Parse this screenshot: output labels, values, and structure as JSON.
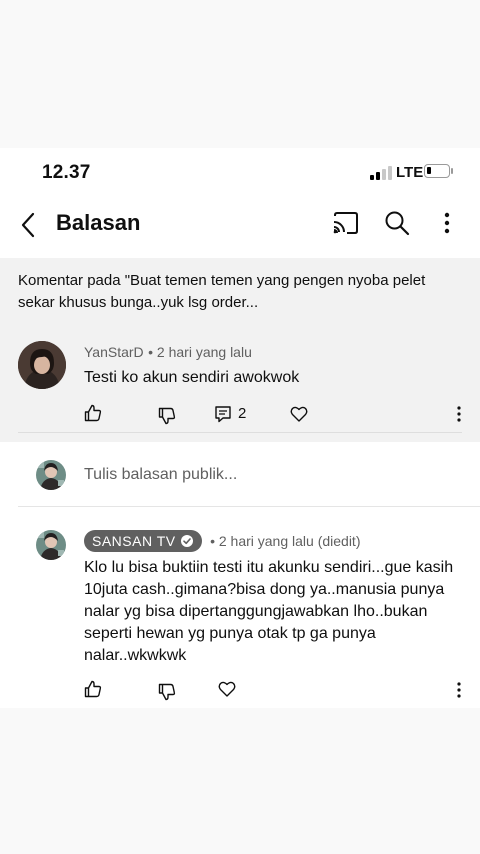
{
  "status_bar": {
    "time": "12.37",
    "network": "LTE"
  },
  "header": {
    "title": "Balasan"
  },
  "context": {
    "text": "Komentar pada \"Buat temen temen yang pengen nyoba pelet sekar khusus bunga..yuk lsg order..."
  },
  "parent_comment": {
    "author": "YanStarD",
    "time": "• 2 hari yang lalu",
    "text": "Testi ko akun sendiri awokwok",
    "reply_count": "2"
  },
  "reply_box": {
    "placeholder": "Tulis balasan publik..."
  },
  "reply": {
    "author": "SANSAN TV",
    "time": "• 2 hari yang lalu (diedit)",
    "text": "Klo lu bisa buktiin testi itu akunku sendiri...gue kasih 10juta cash..gimana?bisa dong ya..manusia punya nalar yg bisa dipertanggungjawabkan lho..bukan seperti hewan yg punya otak tp ga punya nalar..wkwkwk"
  },
  "icons": {
    "back": "chevron-left-icon",
    "cast": "cast-icon",
    "search": "search-icon",
    "more": "more-vert-icon",
    "like": "thumb-up-icon",
    "dislike": "thumb-down-icon",
    "reply": "comment-icon",
    "heart": "heart-icon",
    "verified": "check-circle-icon"
  },
  "colors": {
    "background": "#ffffff",
    "context_bg": "#f2f2f2",
    "badge_bg": "#606060",
    "muted_text": "#606060"
  }
}
